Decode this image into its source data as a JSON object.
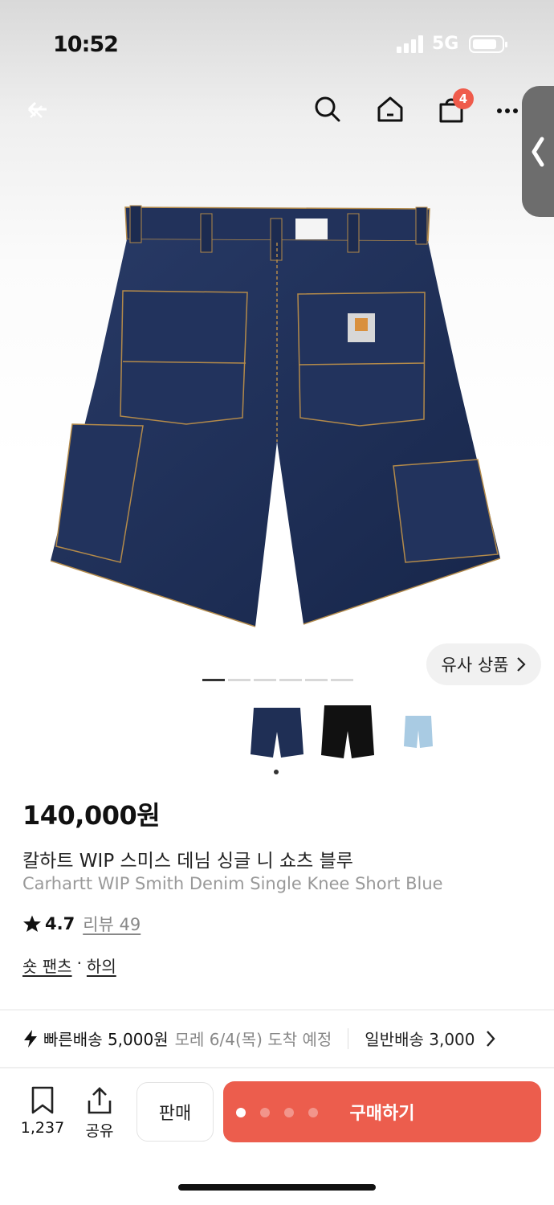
{
  "status_bar": {
    "time": "10:52",
    "network": "5G",
    "battery_level": 0.85
  },
  "nav": {
    "cart_count": "4"
  },
  "similar_button": {
    "label": "유사 상품"
  },
  "gallery": {
    "page_count": 6,
    "current_page": 1,
    "thumbnails": [
      "navy-shorts",
      "black-shorts",
      "light-blue-shorts"
    ]
  },
  "product": {
    "price": "140,000원",
    "title_ko": "칼하트 WIP 스미스 데님 싱글 니 쇼츠 블루",
    "title_en": "Carhartt WIP Smith Denim Single Knee Short Blue",
    "rating": "4.7",
    "review_label": "리뷰 49",
    "category_main": "숏 팬츠",
    "category_separator": "·",
    "category_sub": "하의"
  },
  "shipping": {
    "fast_label": "빠른배송 5,000원",
    "fast_note": "모레 6/4(목) 도착 예정",
    "normal_label": "일반배송 3,000"
  },
  "bottom_bar": {
    "bookmark_count": "1,237",
    "share_label": "공유",
    "sell_label": "판매",
    "buy_label": "구매하기"
  },
  "colors": {
    "accent": "#ec5d4d",
    "denim": "#1f2f55"
  }
}
